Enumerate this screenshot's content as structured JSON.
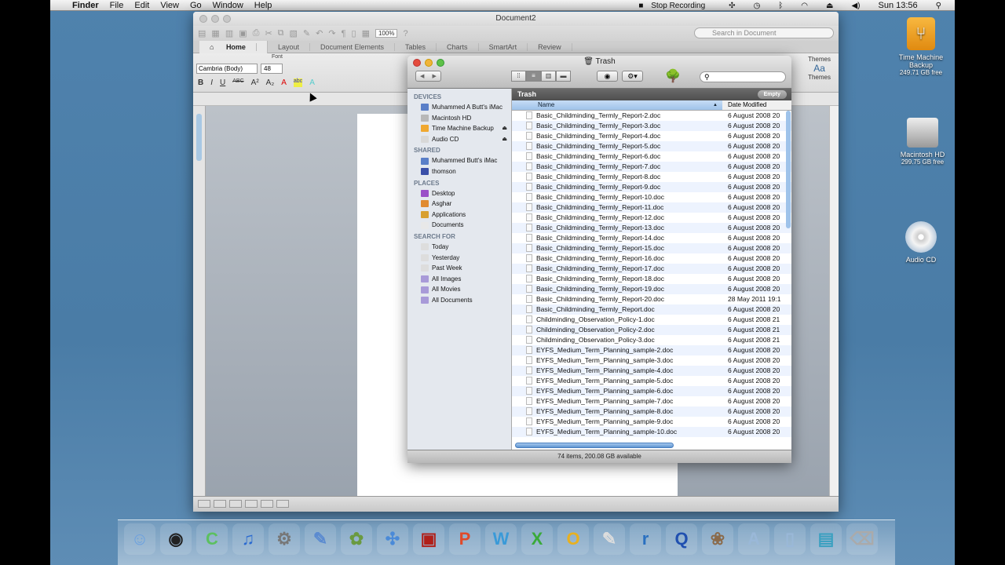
{
  "menubar": {
    "app": "Finder",
    "items": [
      "File",
      "Edit",
      "View",
      "Go",
      "Window",
      "Help"
    ],
    "recording": "Stop Recording",
    "clock": "Sun 13:56"
  },
  "word": {
    "title": "Document2",
    "zoom": "100%",
    "search_placeholder": "Search in Document",
    "tabs": [
      "Home",
      "Layout",
      "Document Elements",
      "Tables",
      "Charts",
      "SmartArt",
      "Review"
    ],
    "font_group": "Font",
    "font": "Cambria (Body)",
    "size": "48",
    "themes_label": "Themes"
  },
  "finder": {
    "title": "Trash",
    "header": "Trash",
    "empty_label": "Empty",
    "col_name": "Name",
    "col_date": "Date Modified",
    "status": "74 items, 200.08 GB available",
    "sidebar": [
      {
        "heading": "DEVICES",
        "items": [
          {
            "label": "Muhammed A Butt's iMac",
            "color": "#5a7fc8"
          },
          {
            "label": "Macintosh HD",
            "color": "#b8b8b8"
          },
          {
            "label": "Time Machine Backup",
            "color": "#f0a830",
            "eject": true
          },
          {
            "label": "Audio CD",
            "color": "#d8d8d8",
            "eject": true
          }
        ]
      },
      {
        "heading": "SHARED",
        "items": [
          {
            "label": "Muhammed Butt's iMac",
            "color": "#5a7fc8"
          },
          {
            "label": "thomson",
            "color": "#3a4fa8"
          }
        ]
      },
      {
        "heading": "PLACES",
        "items": [
          {
            "label": "Desktop",
            "color": "#9a4fc8"
          },
          {
            "label": "Asghar",
            "color": "#e08a30"
          },
          {
            "label": "Applications",
            "color": "#d8a030"
          },
          {
            "label": "Documents",
            "color": "#e8e8e8"
          }
        ]
      },
      {
        "heading": "SEARCH FOR",
        "items": [
          {
            "label": "Today",
            "color": "#ddd"
          },
          {
            "label": "Yesterday",
            "color": "#ddd"
          },
          {
            "label": "Past Week",
            "color": "#ddd"
          },
          {
            "label": "All Images",
            "color": "#a89ad8"
          },
          {
            "label": "All Movies",
            "color": "#a89ad8"
          },
          {
            "label": "All Documents",
            "color": "#a89ad8"
          }
        ]
      }
    ],
    "files": [
      [
        "Basic_Childminding_Termly_Report-2.doc",
        "6 August 2008 20"
      ],
      [
        "Basic_Childminding_Termly_Report-3.doc",
        "6 August 2008 20"
      ],
      [
        "Basic_Childminding_Termly_Report-4.doc",
        "6 August 2008 20"
      ],
      [
        "Basic_Childminding_Termly_Report-5.doc",
        "6 August 2008 20"
      ],
      [
        "Basic_Childminding_Termly_Report-6.doc",
        "6 August 2008 20"
      ],
      [
        "Basic_Childminding_Termly_Report-7.doc",
        "6 August 2008 20"
      ],
      [
        "Basic_Childminding_Termly_Report-8.doc",
        "6 August 2008 20"
      ],
      [
        "Basic_Childminding_Termly_Report-9.doc",
        "6 August 2008 20"
      ],
      [
        "Basic_Childminding_Termly_Report-10.doc",
        "6 August 2008 20"
      ],
      [
        "Basic_Childminding_Termly_Report-11.doc",
        "6 August 2008 20"
      ],
      [
        "Basic_Childminding_Termly_Report-12.doc",
        "6 August 2008 20"
      ],
      [
        "Basic_Childminding_Termly_Report-13.doc",
        "6 August 2008 20"
      ],
      [
        "Basic_Childminding_Termly_Report-14.doc",
        "6 August 2008 20"
      ],
      [
        "Basic_Childminding_Termly_Report-15.doc",
        "6 August 2008 20"
      ],
      [
        "Basic_Childminding_Termly_Report-16.doc",
        "6 August 2008 20"
      ],
      [
        "Basic_Childminding_Termly_Report-17.doc",
        "6 August 2008 20"
      ],
      [
        "Basic_Childminding_Termly_Report-18.doc",
        "6 August 2008 20"
      ],
      [
        "Basic_Childminding_Termly_Report-19.doc",
        "6 August 2008 20"
      ],
      [
        "Basic_Childminding_Termly_Report-20.doc",
        "28 May 2011 19:1"
      ],
      [
        "Basic_Childminding_Termly_Report.doc",
        "6 August 2008 20"
      ],
      [
        "Childminding_Observation_Policy-1.doc",
        "6 August 2008 21"
      ],
      [
        "Childminding_Observation_Policy-2.doc",
        "6 August 2008 21"
      ],
      [
        "Childminding_Observation_Policy-3.doc",
        "6 August 2008 21"
      ],
      [
        "EYFS_Medium_Term_Planning_sample-2.doc",
        "6 August 2008 20"
      ],
      [
        "EYFS_Medium_Term_Planning_sample-3.doc",
        "6 August 2008 20"
      ],
      [
        "EYFS_Medium_Term_Planning_sample-4.doc",
        "6 August 2008 20"
      ],
      [
        "EYFS_Medium_Term_Planning_sample-5.doc",
        "6 August 2008 20"
      ],
      [
        "EYFS_Medium_Term_Planning_sample-6.doc",
        "6 August 2008 20"
      ],
      [
        "EYFS_Medium_Term_Planning_sample-7.doc",
        "6 August 2008 20"
      ],
      [
        "EYFS_Medium_Term_Planning_sample-8.doc",
        "6 August 2008 20"
      ],
      [
        "EYFS_Medium_Term_Planning_sample-9.doc",
        "6 August 2008 20"
      ],
      [
        "EYFS_Medium_Term_Planning_sample-10.doc",
        "6 August 2008 20"
      ]
    ]
  },
  "desktop": [
    {
      "label": "Time Machine Backup",
      "sub": "249.71 GB free"
    },
    {
      "label": "Macintosh HD",
      "sub": "299.75 GB free"
    },
    {
      "label": "Audio CD"
    }
  ],
  "dock": [
    {
      "name": "finder",
      "glyph": "☺",
      "color": "#6aa0e0"
    },
    {
      "name": "dashboard",
      "glyph": "◉",
      "color": "#222"
    },
    {
      "name": "vuze",
      "glyph": "C",
      "color": "#5cc060"
    },
    {
      "name": "itunes",
      "glyph": "♫",
      "color": "#2a6ad0"
    },
    {
      "name": "system-preferences",
      "glyph": "⚙",
      "color": "#777"
    },
    {
      "name": "preview",
      "glyph": "✎",
      "color": "#5a8ad0"
    },
    {
      "name": "app-flower",
      "glyph": "✿",
      "color": "#6a9a40"
    },
    {
      "name": "safari",
      "glyph": "✣",
      "color": "#4a8ad8"
    },
    {
      "name": "photo-booth",
      "glyph": "▣",
      "color": "#b0201a"
    },
    {
      "name": "powerpoint",
      "glyph": "P",
      "color": "#e04a2a"
    },
    {
      "name": "word",
      "glyph": "W",
      "color": "#3a9ad8"
    },
    {
      "name": "excel",
      "glyph": "X",
      "color": "#3aaa3a"
    },
    {
      "name": "outlook",
      "glyph": "O",
      "color": "#e8b020"
    },
    {
      "name": "textedit",
      "glyph": "✎",
      "color": "#ddd"
    },
    {
      "name": "realplayer",
      "glyph": "r",
      "color": "#2a70c0"
    },
    {
      "name": "quicktime",
      "glyph": "Q",
      "color": "#2050b0"
    },
    {
      "name": "iphoto",
      "glyph": "❀",
      "color": "#8a6a4a"
    },
    {
      "name": "applications-folder",
      "glyph": "A",
      "color": "#9ab8d8"
    },
    {
      "name": "documents-folder",
      "glyph": "▯",
      "color": "#9ab8d8"
    },
    {
      "name": "downloads-stack",
      "glyph": "▤",
      "color": "#3aa0c0"
    },
    {
      "name": "trash",
      "glyph": "⌫",
      "color": "#aaa"
    }
  ]
}
